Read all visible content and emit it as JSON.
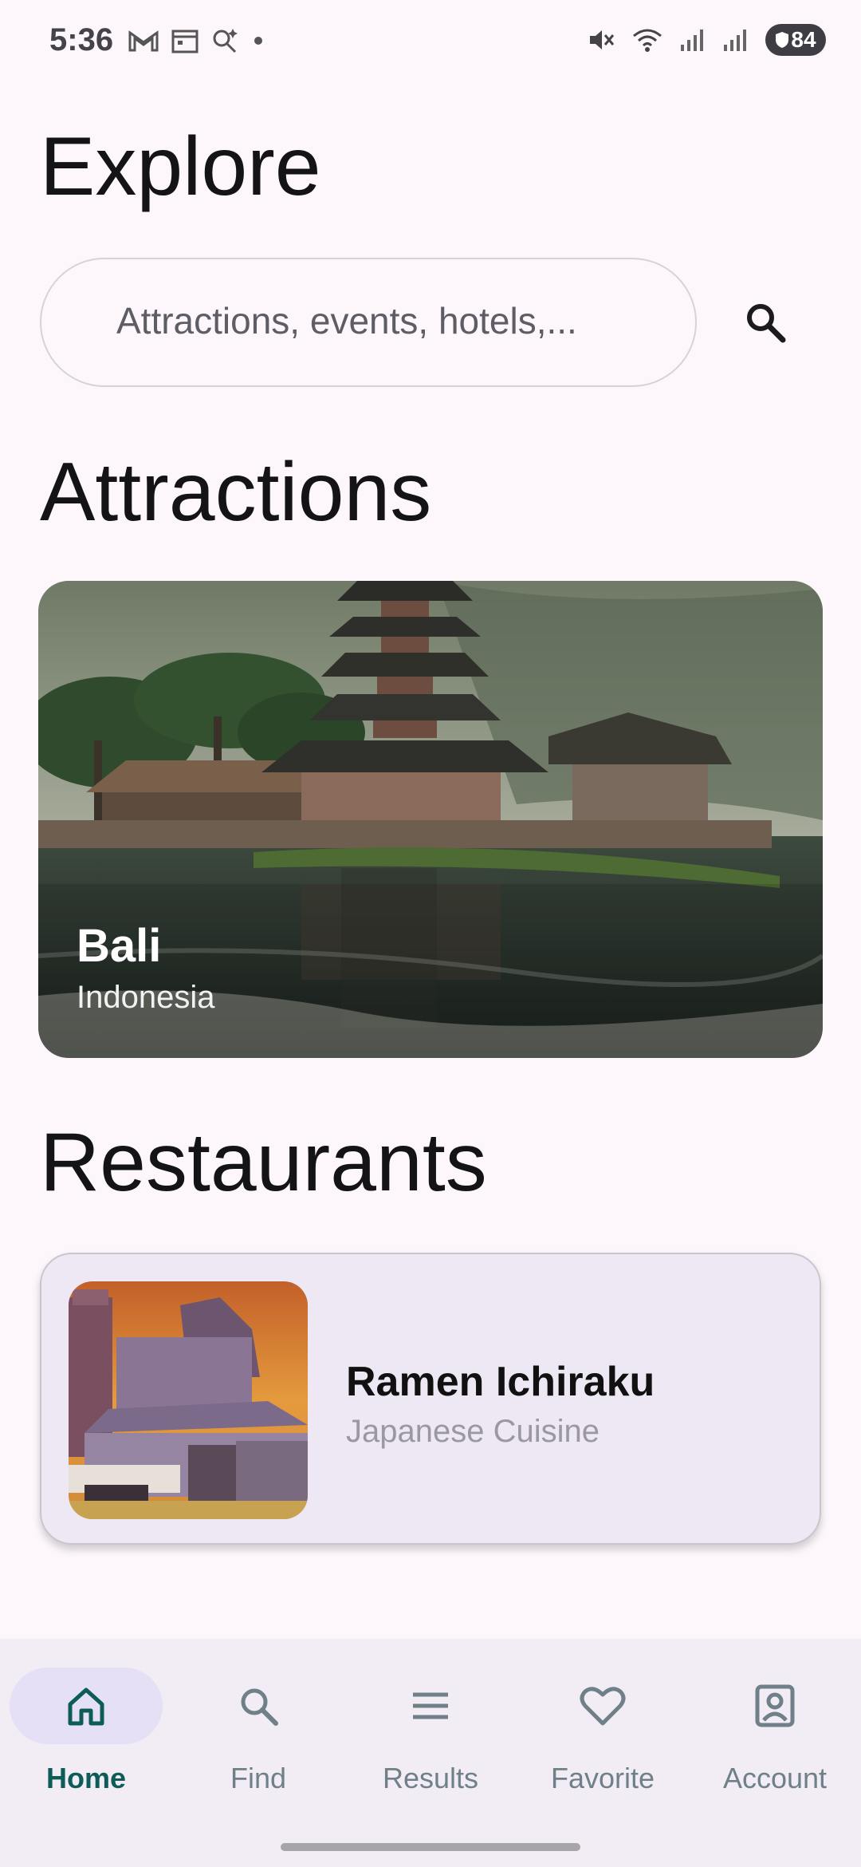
{
  "status_bar": {
    "time": "5:36",
    "left_icons": [
      "gmail-icon",
      "calendar-icon",
      "search-sparkle-icon",
      "dot-icon"
    ],
    "right_icons": [
      "mute-icon",
      "wifi-icon",
      "signal-icon",
      "signal-icon"
    ],
    "battery": "84"
  },
  "header": {
    "title": "Explore"
  },
  "search": {
    "placeholder": "Attractions, events, hotels,..."
  },
  "attractions": {
    "heading": "Attractions",
    "card": {
      "title": "Bali",
      "subtitle": "Indonesia"
    }
  },
  "restaurants": {
    "heading": "Restaurants",
    "card": {
      "name": "Ramen Ichiraku",
      "cuisine": "Japanese Cuisine"
    }
  },
  "bottom_nav": {
    "items": [
      {
        "label": "Home",
        "icon": "home-icon",
        "active": true
      },
      {
        "label": "Find",
        "icon": "search-icon",
        "active": false
      },
      {
        "label": "Results",
        "icon": "menu-icon",
        "active": false
      },
      {
        "label": "Favorite",
        "icon": "heart-icon",
        "active": false
      },
      {
        "label": "Account",
        "icon": "account-icon",
        "active": false
      }
    ]
  },
  "colors": {
    "accent": "#0d5c57",
    "nav_active_bg": "#e6e0f6",
    "background": "#fdf7fc"
  }
}
